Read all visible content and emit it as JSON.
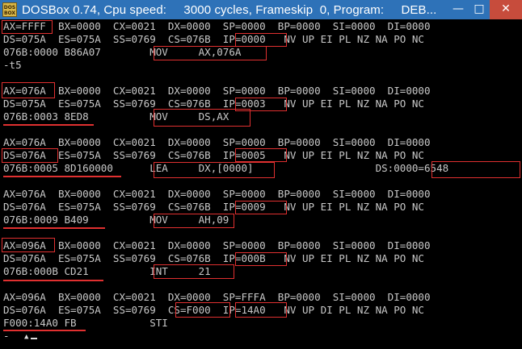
{
  "window": {
    "title": "DOSBox 0.74, Cpu speed:     3000 cycles, Frameskip  0, Program:     DEB...",
    "icon_label": "DOS\nBOX",
    "minimize_label": "—",
    "maximize_label": "□",
    "close_label": "✕"
  },
  "console": {
    "lines": [
      "AX=FFFF  BX=0000  CX=0021  DX=0000  SP=0000  BP=0000  SI=0000  DI=0000",
      "DS=075A  ES=075A  SS=0769  CS=076B  IP=0000   NV UP EI PL NZ NA PO NC",
      "076B:0000 B86A07        MOV     AX,076A",
      "-t5",
      "",
      "AX=076A  BX=0000  CX=0021  DX=0000  SP=0000  BP=0000  SI=0000  DI=0000",
      "DS=075A  ES=075A  SS=0769  CS=076B  IP=0003   NV UP EI PL NZ NA PO NC",
      "076B:0003 8ED8          MOV     DS,AX",
      "",
      "AX=076A  BX=0000  CX=0021  DX=0000  SP=0000  BP=0000  SI=0000  DI=0000",
      "DS=076A  ES=075A  SS=0769  CS=076B  IP=0005   NV UP EI PL NZ NA PO NC",
      "076B:0005 8D160000      LEA     DX,[0000]                    DS:0000=6548",
      "",
      "AX=076A  BX=0000  CX=0021  DX=0000  SP=0000  BP=0000  SI=0000  DI=0000",
      "DS=076A  ES=075A  SS=0769  CS=076B  IP=0009   NV UP EI PL NZ NA PO NC",
      "076B:0009 B409          MOV     AH,09",
      "",
      "AX=096A  BX=0000  CX=0021  DX=0000  SP=0000  BP=0000  SI=0000  DI=0000",
      "DS=076A  ES=075A  SS=0769  CS=076B  IP=000B   NV UP EI PL NZ NA PO NC",
      "076B:000B CD21          INT     21",
      "",
      "AX=096A  BX=0000  CX=0021  DX=0000  SP=FFFA  BP=0000  SI=0000  DI=0000",
      "DS=076A  ES=075A  SS=0769  CS=F000  IP=14A0   NV UP DI PL NZ NA PO NC",
      "F000:14A0 FB            STI",
      "-"
    ],
    "cursor_glyph": "▲",
    "highlight_color": "#e03030"
  }
}
